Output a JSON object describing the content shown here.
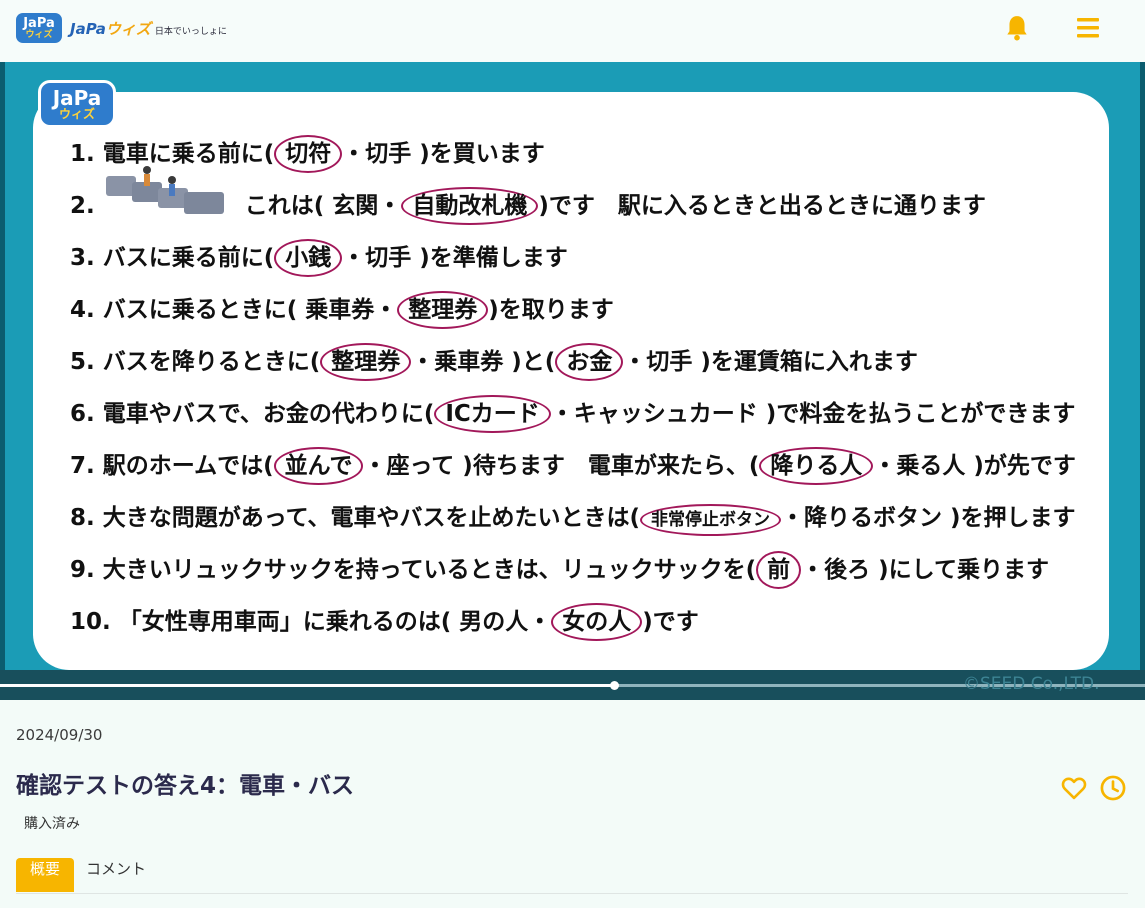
{
  "header": {
    "logo_badge_top": "JaPa",
    "logo_badge_bottom": "ウィズ",
    "logo_name_a": "JaPa",
    "logo_name_b": "ウィズ",
    "logo_tagline": "日本でいっしょに",
    "colors": {
      "brand_blue": "#2f7ccc",
      "accent_yellow": "#f7b500"
    },
    "icons": [
      "bell-icon",
      "hamburger-menu-icon"
    ]
  },
  "video": {
    "watermark_top": "JaPa",
    "watermark_bottom": "ウィズ",
    "progress_fraction": 0.537,
    "copyright": "©SEED Co.,LTD.",
    "questions": [
      {
        "num": "1.",
        "pre": "電車に乗る前に(",
        "c1": "切符",
        "mid": "・切手 )を買います"
      },
      {
        "num": "2.",
        "pre": "これは( 玄関・",
        "c1": "自動改札機",
        "mid": ")です　駅に入るときと出るときに通ります"
      },
      {
        "num": "3.",
        "pre": "バスに乗る前に(",
        "c1": "小銭",
        "mid": "・切手 )を準備します"
      },
      {
        "num": "4.",
        "pre": "バスに乗るときに( 乗車券・",
        "c1": "整理券",
        "mid": ")を取ります"
      },
      {
        "num": "5.",
        "pre": "バスを降りるときに(",
        "c1": "整理券",
        "mid": "・乗車券 )と(",
        "c2": "お金",
        "post": "・切手 )を運賃箱に入れます"
      },
      {
        "num": "6.",
        "pre": "電車やバスで、お金の代わりに(",
        "c1": "ICカード",
        "mid": "・キャッシュカード )で料金を払うことができます"
      },
      {
        "num": "7.",
        "pre": "駅のホームでは(",
        "c1": "並んで",
        "mid": "・座って )待ちます　電車が来たら、(",
        "c2": "降りる人",
        "post": "・乗る人 )が先です"
      },
      {
        "num": "8.",
        "pre": "大きな問題があって、電車やバスを止めたいときは(",
        "c1": "非常停止ボタン",
        "mid": "・降りるボタン )を押します"
      },
      {
        "num": "9.",
        "pre": "大きいリュックサックを持っているときは、リュックサックを(",
        "c1": "前",
        "mid": "・後ろ )にして乗ります"
      },
      {
        "num": "10.",
        "pre": "「女性専用車両」に乗れるのは( 男の人・",
        "c1": "女の人",
        "mid": ")です"
      }
    ]
  },
  "info": {
    "date": "2024/09/30",
    "title": "確認テストの答え4：電車・バス",
    "status": "購入済み",
    "icons": [
      "heart-icon",
      "clock-icon"
    ]
  },
  "tabs": [
    {
      "label": "概要",
      "active": true
    },
    {
      "label": "コメント",
      "active": false
    }
  ]
}
